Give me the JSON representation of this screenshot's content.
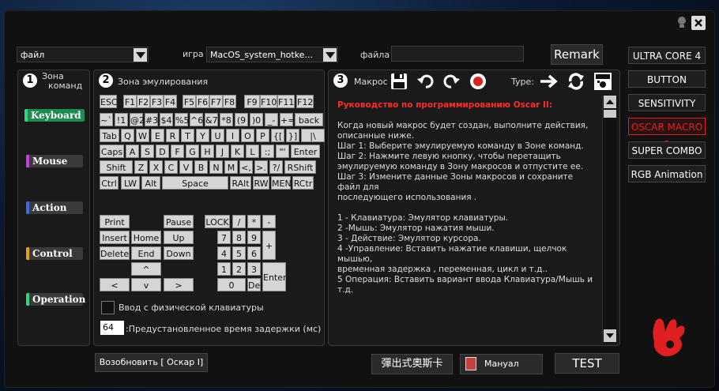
{
  "top": {
    "file_select": "файл",
    "game_label": "игра",
    "game_select": "MacOS_system_hotke...",
    "filename_label": "файла",
    "filename_value": "",
    "remark_button": "Remark"
  },
  "zones": {
    "commands": {
      "num": "1",
      "title": "Зона\nкоманд"
    },
    "emulation": {
      "num": "2",
      "title": "Зона эмулирования"
    },
    "macro": {
      "num": "3",
      "title": "Макрос",
      "type_label": "Type:"
    }
  },
  "commands": [
    {
      "label": "Keyboard",
      "color": "#2fd67e"
    },
    {
      "label": "Mouse",
      "color": "#c040e0"
    },
    {
      "label": "Action",
      "color": "#3a6ae8"
    },
    {
      "label": "Control",
      "color": "#e0a020"
    },
    {
      "label": "Operation",
      "color": "#2fd67e"
    }
  ],
  "keyboard": {
    "fn_row": [
      "ESC",
      "F1",
      "F2",
      "F3",
      "F4",
      "F5",
      "F6",
      "F7",
      "F8",
      "F9",
      "F10",
      "F11",
      "F12"
    ],
    "row1": [
      "~`",
      "!1",
      "@2",
      "#3",
      "$4",
      "%5",
      "^6",
      "&7",
      "*8",
      "(9",
      ")0",
      "_-",
      "+=",
      "back"
    ],
    "row2": [
      "Tab",
      "Q",
      "W",
      "E",
      "R",
      "T",
      "Y",
      "U",
      "I",
      "O",
      "P",
      "{[",
      "}]",
      "|\\"
    ],
    "row3": [
      "Caps",
      "A",
      "S",
      "D",
      "F",
      "G",
      "H",
      "J",
      "K",
      "L",
      ":;",
      "\"'",
      "Enter"
    ],
    "row4": [
      "Shift",
      "Z",
      "X",
      "C",
      "V",
      "B",
      "N",
      "M",
      "<,",
      ">.",
      "?/",
      "RShift"
    ],
    "row5": [
      "Ctrl",
      "LW",
      "Alt",
      "Space",
      "RAlt",
      "RW",
      "MENU",
      "RCtr"
    ],
    "nav": [
      "Print",
      "Pause",
      "Insert",
      "Home",
      "Up",
      "Delete",
      "End",
      "Down",
      "^",
      "<",
      "v",
      ">"
    ],
    "numpad": [
      "LOCK",
      "/",
      "*",
      "-",
      "7",
      "8",
      "9",
      "+",
      "4",
      "5",
      "6",
      "1",
      "2",
      "3",
      "Enter",
      "0",
      "Del"
    ]
  },
  "physical_input_label": "Ввод с физической клавиатуры",
  "delay": {
    "value": "64",
    "label": ":Предустановленное время задержки (мс)"
  },
  "restore_button": "Возобновить [ Оскар I]",
  "guide": {
    "title": "Руководство по программированию Oscar II:",
    "lines": [
      "",
      "Когда новый макрос будет создан, выполните действия,",
      "описанные ниже.",
      "Шаг 1: Выберите эмулируемую команду в Зоне команд.",
      "Шаг 2: Нажмите левую кнопку, чтобы перетащить",
      "эмулируемую команду в Зону макросов и отпустите ее.",
      "Шаг 3: Измените данные Зоны макросов и сохраните файл для",
      "последующего использования .",
      "",
      "1 - Клавиатура: Эмулятор клавиатуры.",
      "2 -Мышь: Эмулятор нажатия мыши.",
      "3 - Действие: Эмулятор курсора.",
      "4 -Управление: Вставить нажатие клавиши, щелчок мышью,",
      "временная задержка , переменная, цикл и т.д..",
      "5 Операция: Вставить вариант ввода Клавиатура/Мышь и т.д."
    ]
  },
  "bottom": {
    "chinese_button": "彈出式奧斯卡",
    "manual_button": "Мануал",
    "test_button": "TEST"
  },
  "sidebar": [
    {
      "label": "ULTRA CORE 4",
      "active": false
    },
    {
      "label": "BUTTON",
      "active": false
    },
    {
      "label": "SENSITIVITY",
      "active": false
    },
    {
      "label": "OSCAR MACRO 2",
      "active": true
    },
    {
      "label": "SUPER COMBO",
      "active": false
    },
    {
      "label": "RGB Animation",
      "active": false
    }
  ],
  "colors": {
    "accent": "#e02020",
    "guide_title": "#ff2a2a"
  }
}
